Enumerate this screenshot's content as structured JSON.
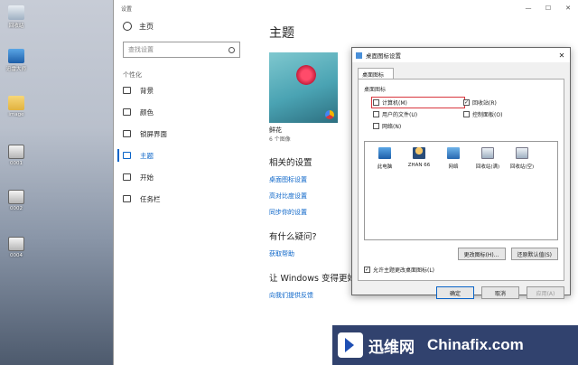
{
  "desktop": {
    "icons": [
      {
        "label": "回收站",
        "icon": "recycle-bin-icon"
      },
      {
        "label": "迅雷大师",
        "icon": "computer-icon"
      },
      {
        "label": "image",
        "icon": "folder-icon"
      },
      {
        "label": "0001",
        "icon": "image-file-icon"
      },
      {
        "label": "0002",
        "icon": "image-file-icon"
      },
      {
        "label": "0004",
        "icon": "image-file-icon"
      }
    ]
  },
  "settings": {
    "window_title": "设置",
    "controls": [
      "—",
      "☐",
      "✕"
    ],
    "home_label": "主页",
    "search_placeholder": "查找设置",
    "section_label": "个性化",
    "nav": [
      {
        "label": "背景",
        "icon": "image-icon"
      },
      {
        "label": "颜色",
        "icon": "palette-icon"
      },
      {
        "label": "锁屏界面",
        "icon": "monitor-icon"
      },
      {
        "label": "主题",
        "icon": "brush-icon"
      },
      {
        "label": "开始",
        "icon": "start-menu-icon"
      },
      {
        "label": "任务栏",
        "icon": "taskbar-icon"
      }
    ],
    "active_nav": "主题",
    "main": {
      "title": "主题",
      "theme_name": "鲜花",
      "theme_count": "6 个图像",
      "related_title": "相关的设置",
      "related_links": [
        "桌面图标设置",
        "高对比度设置",
        "同步你的设置"
      ],
      "question_title": "有什么疑问?",
      "question_link": "获取帮助",
      "improve_title": "让 Windows 变得更好",
      "improve_link": "向我们提供反馈"
    }
  },
  "dialog": {
    "title": "桌面图标设置",
    "close": "✕",
    "tab": "桌面图标",
    "group_label": "桌面图标",
    "checkboxes": [
      {
        "label": "计算机(M)",
        "checked": false,
        "highlighted": true
      },
      {
        "label": "回收站(R)",
        "checked": true,
        "highlighted": false
      },
      {
        "label": "用户的文件(U)",
        "checked": false,
        "highlighted": false
      },
      {
        "label": "控制面板(O)",
        "checked": false,
        "highlighted": false
      },
      {
        "label": "网络(N)",
        "checked": false,
        "highlighted": false
      }
    ],
    "icons": [
      {
        "label": "此电脑",
        "icon": "computer-icon"
      },
      {
        "label": "ZHAN 66",
        "icon": "user-folder-icon"
      },
      {
        "label": "网络",
        "icon": "network-icon"
      },
      {
        "label": "回收站(满)",
        "icon": "recycle-bin-full-icon"
      },
      {
        "label": "回收站(空)",
        "icon": "recycle-bin-empty-icon"
      }
    ],
    "change_icon_button": "更改图标(H)...",
    "restore_default_button": "还原默认值(S)",
    "allow_themes_label": "允许主题更改桌面图标(L)",
    "allow_themes_checked": true,
    "ok_button": "确定",
    "cancel_button": "取消",
    "apply_button": "应用(A)"
  },
  "watermark": {
    "text_cn": "迅维网",
    "text_en": "Chinafix.com"
  }
}
